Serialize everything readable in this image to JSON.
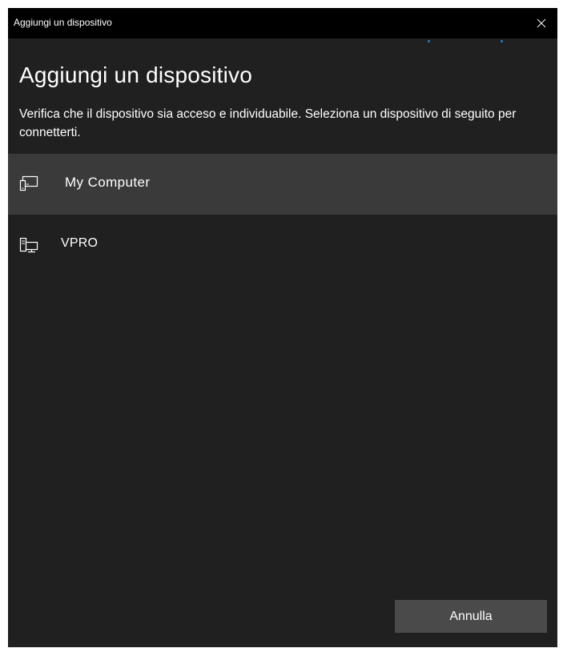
{
  "window": {
    "title": "Aggiungi un dispositivo",
    "close_icon": "close-icon"
  },
  "main": {
    "heading": "Aggiungi un dispositivo",
    "description": "Verifica che il dispositivo sia acceso e individuabile. Seleziona un dispositivo di seguito per connetterti."
  },
  "devices": [
    {
      "name": "My Computer",
      "icon": "display-device-icon",
      "selected": true
    },
    {
      "name": "VPRO",
      "icon": "desktop-pc-icon",
      "selected": false
    }
  ],
  "footer": {
    "cancel_label": "Annulla"
  },
  "colors": {
    "background": "#202020",
    "titlebar": "#000000",
    "selected_row": "#3a3a3a",
    "button": "#4a4a4a",
    "text": "#ffffff",
    "accent_dots": "#1e7fd6"
  }
}
